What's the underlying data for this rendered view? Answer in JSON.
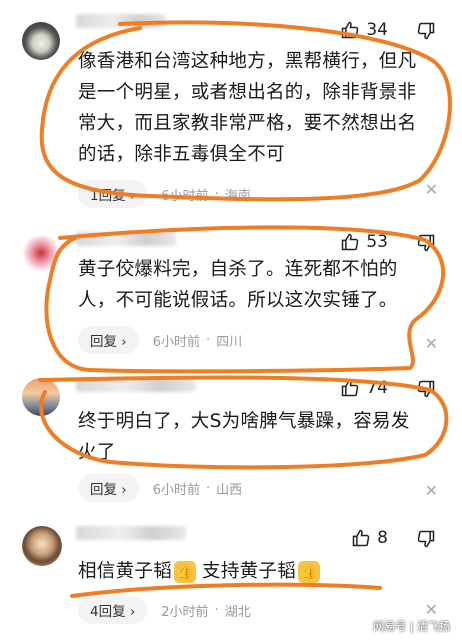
{
  "comments": [
    {
      "likes": "34",
      "body": "像香港和台湾这种地方，黑帮横行，但凡是一个明星，或者想出名的，除非背景非常大，而且家教非常严格，要不然想出名的话，除非五毒俱全不可",
      "reply_label": "1回复 ›",
      "time": "6小时前",
      "location": "海南"
    },
    {
      "likes": "53",
      "body": "黄子佼爆料完，自杀了。连死都不怕的人，不可能说假话。所以这次实锤了。",
      "reply_label": "回复 ›",
      "time": "6小时前",
      "location": "四川"
    },
    {
      "likes": "74",
      "body": "终于明白了，大S为啥脾气暴躁，容易发火了",
      "reply_label": "回复 ›",
      "time": "6小时前",
      "location": "山西"
    },
    {
      "likes": "8",
      "body_part1": "相信黄子韬",
      "body_part2": "支持黄子韬",
      "reply_label": "4回复 ›",
      "time": "2小时前",
      "location": "湖北"
    }
  ],
  "separator": "·",
  "icons": {
    "like": "thumbs-up-icon",
    "dislike": "thumbs-down-icon",
    "close": "close-icon",
    "emoji": "thumbs-up-emoji-icon"
  },
  "colors": {
    "annotation_ink": "#f07d22",
    "meta_text": "#9a9a9a"
  },
  "watermark": "网易号 | 清飞扬"
}
